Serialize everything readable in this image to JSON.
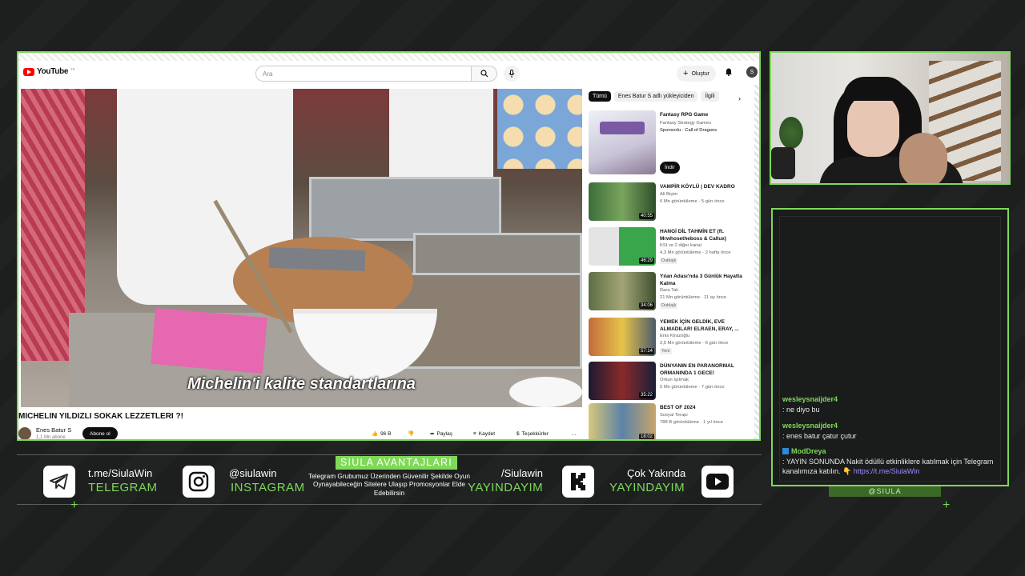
{
  "youtube": {
    "logo_text": "YouTube",
    "logo_region": "TR",
    "search_placeholder": "Ara",
    "create_label": "Oluştur",
    "avatar_letter": "S",
    "video": {
      "subtitle": "Michelin'i kalite standartlarına",
      "title": "MICHELIN YILDIZLI SOKAK LEZZETLERI ?!",
      "channel": "Enes Batur S",
      "subscribers": "1,1 Mn abone",
      "subscribe_label": "Abone ol",
      "likes": "96 B",
      "share_label": "Paylaş",
      "save_label": "Kaydet",
      "thanks_label": "Teşekkürler",
      "more_label": "…"
    },
    "chips": [
      "Tümü",
      "Enes Batur S adlı yükleyiciden",
      "İlgili"
    ],
    "recommendations": [
      {
        "title": "Fantasy RPG Game",
        "channel": "Fantasy Strategy Games",
        "meta": "Sponsorlu · Call of Dragons",
        "button": "İndir",
        "duration": "",
        "badge": ""
      },
      {
        "title": "VAMPİR KÖYLÜ | DEV KADRO",
        "channel": "Ali Biçim",
        "meta": "6 Mn görüntüleme · 5 gün önce",
        "duration": "40:55",
        "badge": ""
      },
      {
        "title": "HANGİ DİL TAHMİN ET (ft. Mrwhosetheboss & Callux)",
        "channel": "KSI ve 2 diğer kanal",
        "meta": "4,3 Mn görüntüleme · 2 hafta önce",
        "duration": "46:29",
        "badge": "Dublajlı"
      },
      {
        "title": "Yılan Adası'nda 3 Günlük Hayatta Kalma",
        "channel": "Dara Talı",
        "meta": "21 Mn görüntüleme · 11 ay önce",
        "duration": "34:06",
        "badge": "Dublajlı"
      },
      {
        "title": "YEMEK İÇİN GELDİK, EVE ALMADILAR! ELRAEN, ERAY, ...",
        "channel": "Enis Kirazoğlu",
        "meta": "2,5 Mn görüntüleme · 6 gün önce",
        "duration": "57:14",
        "badge": "Yeni"
      },
      {
        "title": "DÜNYANIN EN PARANORMAL ORMANINDA 1 GECE!",
        "channel": "Orkun Işıtmak",
        "meta": "5 Mn görüntüleme · 7 gün önce",
        "duration": "35:22",
        "badge": ""
      },
      {
        "title": "BEST OF 2024",
        "channel": "Sosyal Terapi",
        "meta": "788 B görüntüleme · 1 yıl önce",
        "duration": "18:02",
        "badge": ""
      }
    ]
  },
  "chat": {
    "messages": [
      {
        "user": "wesleysnaijder4",
        "text": ": ne diyo bu"
      },
      {
        "user": "wesleysnaijder4",
        "text": ": enes batur çatur çutur"
      },
      {
        "user": "ModDreya",
        "text": ": YAYIN SONUNDA Nakit ödüllü etkinliklere katılmak için Telegram kanalımıza katılın. 👇",
        "link": "https://t.me/SiulaWin"
      }
    ],
    "streamer_tag": "@SIULA"
  },
  "bottom_bar": {
    "telegram": {
      "top": "t.me/SiulaWin",
      "bottom": "TELEGRAM"
    },
    "instagram": {
      "top": "@siulawin",
      "bottom": "INSTAGRAM"
    },
    "promo_title": "SIULA AVANTAJLARI",
    "promo_text": "Telegram Grubumuz Üzerinden Güvenilir Şekilde Oyun Oynayabileceğin Sitelere Ulaşıp Promosyonlar Elde Edebilirsin",
    "kick": {
      "top": "/Siulawin",
      "bottom": "YAYINDAYIM"
    },
    "youtube": {
      "top": "Çok Yakında",
      "bottom": "YAYINDAYIM"
    }
  },
  "colors": {
    "accent": "#7ed957",
    "background": "#1d1f1f",
    "youtube_red": "#ff0000"
  }
}
